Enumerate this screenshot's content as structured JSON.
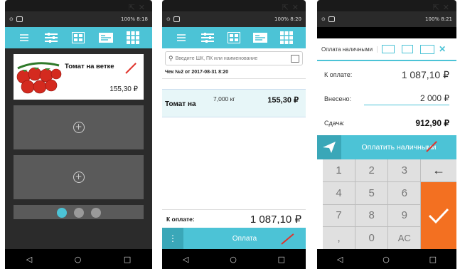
{
  "p1": {
    "product": {
      "name": "Томат на ветке",
      "price": "155,30 ₽"
    },
    "slots": [
      "+",
      "+"
    ],
    "pager": [
      true,
      false,
      false
    ]
  },
  "p2": {
    "search_placeholder": "Введите ШК, ПК или наименование",
    "receipt": "Чек №2 от 2017-08-31 8:20",
    "item": {
      "name": "Томат на",
      "qty": "7,000 кг",
      "sum": "155,30 ₽"
    },
    "total_label": "К оплате:",
    "total_value": "1 087,10 ₽",
    "pay_button": "Оплата"
  },
  "p3": {
    "tab_label": "Оплата наличными",
    "due_label": "К оплате:",
    "due_value": "1 087,10 ₽",
    "paid_label": "Внесено:",
    "paid_value": "2 000 ₽",
    "change_label": "Сдача:",
    "change_value": "912,90 ₽",
    "pay_button": "Оплатить наличными",
    "keys": [
      "1",
      "2",
      "3",
      "←",
      "4",
      "5",
      "6",
      "",
      "7",
      "8",
      "9",
      "",
      ",",
      "0",
      "AC",
      ""
    ]
  },
  "status": {
    "p1": "100% 8:18",
    "p2": "100% 8:20",
    "p3": "100% 8:21"
  },
  "colors": {
    "accent": "#4cc3d6",
    "orange": "#f37021",
    "arrow": "#e0342c"
  }
}
